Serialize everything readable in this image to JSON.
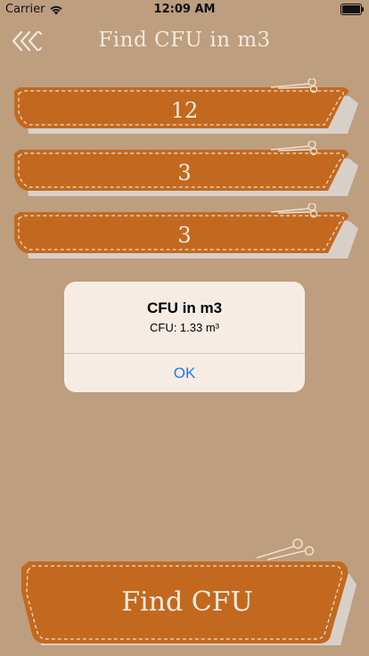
{
  "status_bar": {
    "carrier": "Carrier",
    "time": "12:09 AM"
  },
  "nav": {
    "title": "Find CFU in m3",
    "back_icon": "triple-chevron-left-icon"
  },
  "fields": [
    {
      "value": "12"
    },
    {
      "value": "3"
    },
    {
      "value": "3"
    }
  ],
  "action_button": {
    "label": "Find CFU"
  },
  "alert": {
    "title": "CFU in m3",
    "message": "CFU: 1.33 m³",
    "ok_label": "OK"
  },
  "colors": {
    "background": "#bd9e7f",
    "field_fill": "#c2691f",
    "field_shadow": "#d7d0c9",
    "stitch": "#f1dfcc",
    "alert_bg": "#f6ece4",
    "link_blue": "#1a7cf2"
  }
}
